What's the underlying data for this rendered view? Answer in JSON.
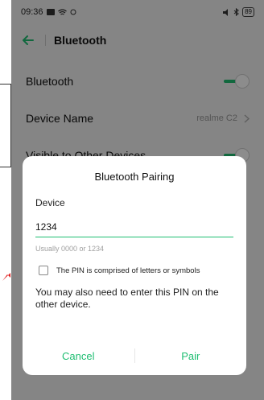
{
  "statusbar": {
    "time": "09:36",
    "battery": "89"
  },
  "appbar": {
    "title": "Bluetooth"
  },
  "settings": {
    "rows": [
      {
        "label": "Bluetooth",
        "toggle_on": true
      },
      {
        "label": "Device Name",
        "value": "realme C2"
      },
      {
        "label": "Visible to Other Devices",
        "toggle_on": true
      }
    ]
  },
  "dialog": {
    "title": "Bluetooth Pairing",
    "device_label": "Device",
    "pin_value": "1234",
    "hint": "Usually 0000 or 1234",
    "checkbox_label": "The PIN is comprised of letters or symbols",
    "note": "You may also need to enter this PIN on the other device.",
    "cancel_label": "Cancel",
    "pair_label": "Pair"
  },
  "colors": {
    "accent": "#1fbe72",
    "annotation_arrow": "#e02020"
  }
}
